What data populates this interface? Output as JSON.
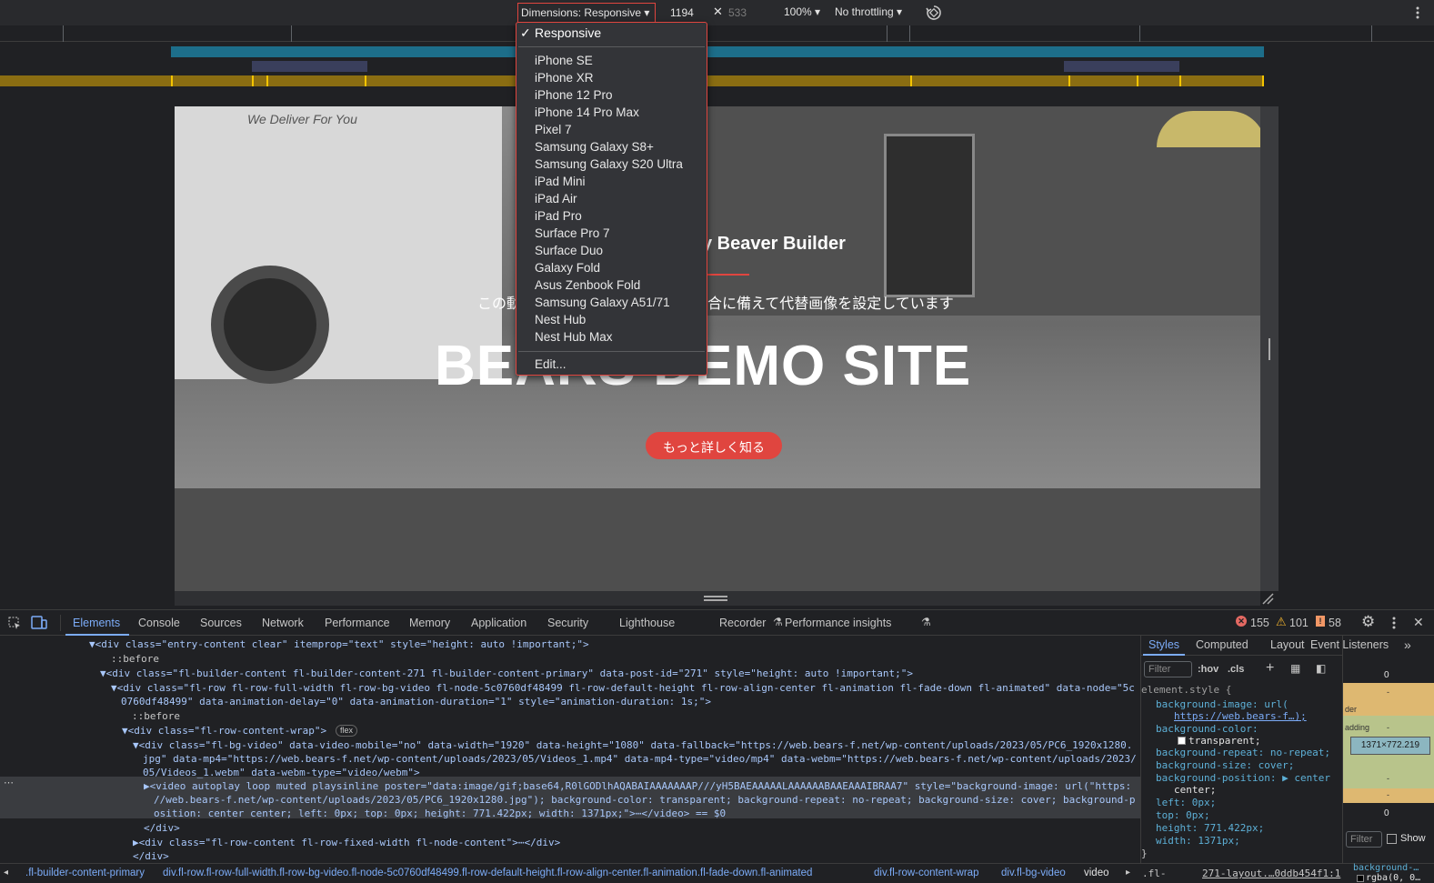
{
  "toolbar": {
    "dimensions_label": "Dimensions: Responsive ▾",
    "width": "1194",
    "times": "✕",
    "height": "533",
    "zoom": "100% ▾",
    "throttle": "No throttling ▾"
  },
  "menu": {
    "selected": "Responsive",
    "items": [
      "iPhone SE",
      "iPhone XR",
      "iPhone 12 Pro",
      "iPhone 14 Pro Max",
      "Pixel 7",
      "Samsung Galaxy S8+",
      "Samsung Galaxy S20 Ultra",
      "iPad Mini",
      "iPad Air",
      "iPad Pro",
      "Surface Pro 7",
      "Surface Duo",
      "Galaxy Fold",
      "Asus Zenbook Fold",
      "Samsung Galaxy A51/71",
      "Nest Hub",
      "Nest Hub Max"
    ],
    "edit": "Edit..."
  },
  "site": {
    "truck_text": "We Deliver For You",
    "subtitle": "y Beaver Builder",
    "desc_left": "この動",
    "desc_right": "合に備えて代替画像を設定しています",
    "hero": "BEARS DEMO SITE",
    "cta": "もっと詳しく知る"
  },
  "devtools": {
    "tabs": [
      "Elements",
      "Console",
      "Sources",
      "Network",
      "Performance",
      "Memory",
      "Application",
      "Security",
      "Lighthouse",
      "Recorder",
      "Performance insights"
    ],
    "errors": "155",
    "warnings": "101",
    "issues": "58",
    "side_tabs": [
      "Styles",
      "Computed",
      "Layout",
      "Event Listeners"
    ],
    "filter_placeholder": "Filter",
    "hov": ":hov",
    "cls": ".cls",
    "box_size": "1371×772.219",
    "box_zero": "0",
    "box_dash": "-",
    "box_border": "der",
    "box_padding": "adding",
    "box_filter": "Filter",
    "box_show": "Show",
    "box_bg": "background-…",
    "box_rgba": "rgba(0, 0…"
  },
  "code": [
    "▼<div class=\"entry-content clear\" itemprop=\"text\" style=\"height: auto !important;\">",
    "::before",
    "▼<div class=\"fl-builder-content fl-builder-content-271 fl-builder-content-primary\" data-post-id=\"271\" style=\"height: auto !important;\">",
    "▼<div class=\"fl-row fl-row-full-width fl-row-bg-video fl-node-5c0760df48499 fl-row-default-height fl-row-align-center fl-animation fl-fade-down fl-animated\" data-node=\"5c",
    "0760df48499\" data-animation-delay=\"0\" data-animation-duration=\"1\" style=\"animation-duration: 1s;\">",
    "::before",
    "▼<div class=\"fl-row-content-wrap\">",
    "▼<div class=\"fl-bg-video\" data-video-mobile=\"no\" data-width=\"1920\" data-height=\"1080\" data-fallback=\"https://web.bears-f.net/wp-content/uploads/2023/05/PC6_1920x1280.",
    "jpg\" data-mp4=\"https://web.bears-f.net/wp-content/uploads/2023/05/Videos_1.mp4\" data-mp4-type=\"video/mp4\" data-webm=\"https://web.bears-f.net/wp-content/uploads/2023/",
    "05/Videos_1.webm\" data-webm-type=\"video/webm\">",
    "▶<video autoplay loop muted playsinline poster=\"data:image/gif;base64,R0lGODlhAQABAIAAAAAAAP///yH5BAEAAAAALAAAAAABAAEAAAIBRAA7\" style=\"background-image: url(\"https:",
    "//web.bears-f.net/wp-content/uploads/2023/05/PC6_1920x1280.jpg\"); background-color: transparent; background-repeat: no-repeat; background-size: cover; background-p",
    "osition: center center; left: 0px; top: 0px; height: 771.422px; width: 1371px;\">⋯</video> == $0",
    "</div>",
    "▶<div class=\"fl-row-content fl-row-fixed-width fl-node-content\">⋯</div>",
    "</div>"
  ],
  "flex_badge": "flex",
  "styles": [
    "element.style {",
    "background-image: url(",
    "https://web.bears-f…);",
    "background-color:",
    "transparent;",
    "background-repeat: no-repeat;",
    "background-size: cover;",
    "background-position: ▶ center",
    "center;",
    "left: 0px;",
    "top: 0px;",
    "height: 771.422px;",
    "width: 1371px;",
    "}",
    ".fl-",
    "271-layout.…0ddb454f1:1"
  ],
  "crumbs": [
    ".fl-builder-content-primary",
    "div.fl-row.fl-row-full-width.fl-row-bg-video.fl-node-5c0760df48499.fl-row-default-height.fl-row-align-center.fl-animation.fl-fade-down.fl-animated",
    "div.fl-row-content-wrap",
    "div.fl-bg-video",
    "video"
  ],
  "colors": {
    "accent": "#e0453f",
    "cta": "#e0453f",
    "link": "#7cacf8"
  }
}
